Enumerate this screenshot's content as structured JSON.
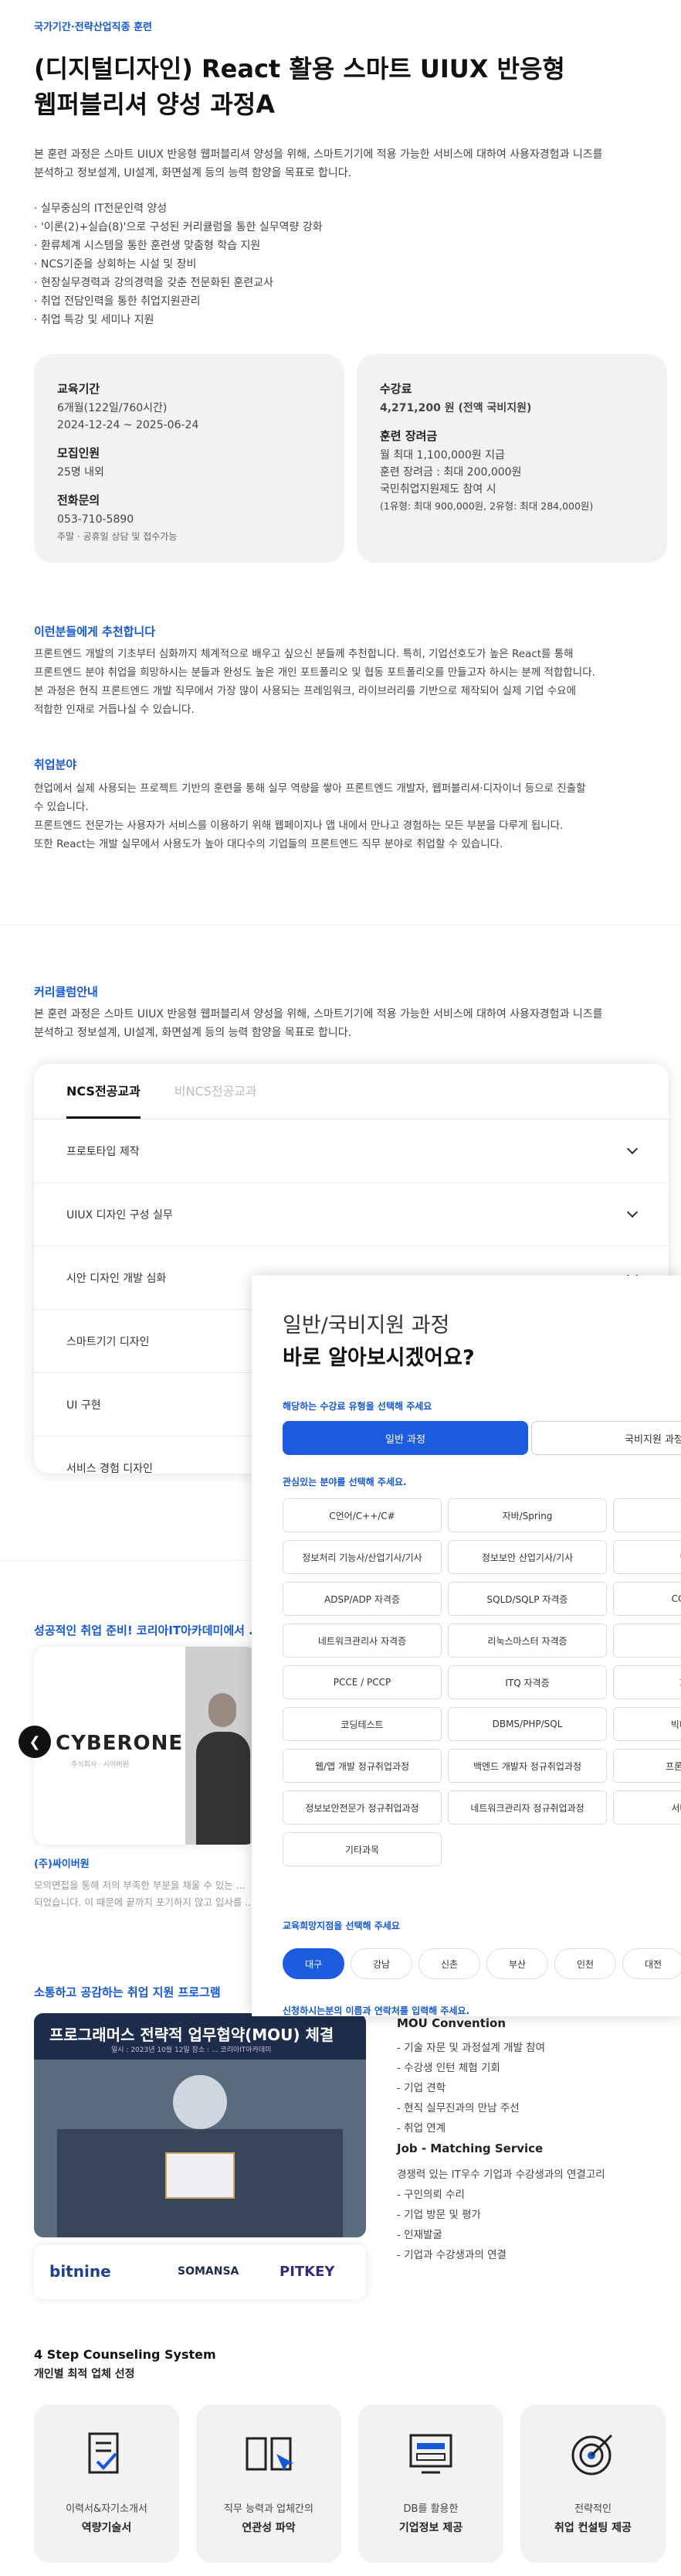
{
  "header": {
    "category": "국가기간·전략산업직종 훈련",
    "title_line1": "(디지털디자인) React 활용 스마트 UIUX 반응형",
    "title_line2": "웹퍼블리셔 양성 과정A"
  },
  "intro": {
    "line1": "본 훈련 과정은 스마트 UIUX 반응형 웹퍼블리셔 양성을 위해, 스마트기기에 적용 가능한 서비스에 대하여 사용자경험과 니즈를",
    "line2": "분석하고 정보설계, UI설계, 화면설계 등의 능력 함양을 목표로 합니다."
  },
  "features": [
    "· 실무중심의 IT전문인력 양성",
    "· '이론(2)+실습(8)'으로 구성된 커리큘럼을 통한 실무역량 강화",
    "· 환류체계 시스템을 통한 훈련생 맞춤형 학습 지원",
    "· NCS기준을 상회하는 시설 및 장비",
    "· 현장실무경력과 강의경력을 갖춘 전문화된 훈련교사",
    "· 취업 전담인력을 통한 취업지원관리",
    "· 취업 특강 및 세미나 지원"
  ],
  "info_left": {
    "period_label": "교육기간",
    "period_v1": "6개월(122일/760시간)",
    "period_v2": "2024-12-24 ~ 2025-06-24",
    "recruit_label": "모집인원",
    "recruit_v": "25명 내외",
    "contact_label": "전화문의",
    "contact_v1": "053-710-5890",
    "contact_v2": "주말 · 공휴일 상담 및 접수가능"
  },
  "info_right": {
    "fee_label": "수강료",
    "fee_v": "4,271,200 원 (전액 국비지원)",
    "incentive_label": "훈련 장려금",
    "incentive_v1": "월 최대 1,100,000원 지급",
    "incentive_v2": "훈련 장려금 : 최대 200,000원",
    "incentive_v3": "국민취업지원제도 참여 시",
    "incentive_v4": "(1유형: 최대 900,000원, 2유형: 최대 284,000원)"
  },
  "recommend": {
    "title": "이런분들에게 추천합니다",
    "l1": "프론트엔드 개발의 기초부터 심화까지 체계적으로 배우고 싶으신 분들께 추천합니다. 특히, 기업선호도가 높은 React를 통해",
    "l2": "프론트엔드 분야 취업을 희망하시는 분들과 완성도 높은 개인 포트폴리오 및 협동 포트폴리오를 만들고자 하시는 분께 적합합니다.",
    "l3": "본 과정은 현직 프론트엔드 개발 직무에서 가장 많이 사용되는 프레임워크, 라이브러리를 기반으로 제작되어 실제 기업 수요에",
    "l4": "적합한 인재로 거듭나실 수 있습니다."
  },
  "jobs": {
    "title": "취업분야",
    "l1": "현업에서 실제 사용되는 프로젝트 기반의 훈련을 통해 실무 역량을 쌓아 프론트엔드 개발자, 웹퍼블리셔·디자이너 등으로 진출할",
    "l2": "수 있습니다.",
    "l3": "프론트엔드 전문가는 사용자가 서비스를 이용하기 위해 웹페이지나 앱 내에서 만나고 경험하는 모든 부분을 다루게 됩니다.",
    "l4": "또한 React는 개발 실무에서 사용도가 높아 대다수의 기업들의 프론트엔드 직무 분야로 취업할 수 있습니다."
  },
  "curriculum": {
    "title": "커리큘럼안내",
    "l1": "본 훈련 과정은 스마트 UIUX 반응형 웹퍼블리셔 양성을 위해, 스마트기기에 적용 가능한 서비스에 대하여 사용자경험과 니즈를",
    "l2": "분석하고 정보설계, UI설계, 화면설계 등의 능력 함양을 목표로 합니다.",
    "tab1": "NCS전공교과",
    "tab2": "비NCS전공교과",
    "items": [
      "프로토타입 제작",
      "UIUX 디자인 구성 실무",
      "시안 디자인 개발 심화",
      "스마트기기 디자인",
      "UI 구현",
      "서비스 경험 디자인"
    ]
  },
  "success": {
    "title": "성공적인 취업 준비! 코리아IT아카데미에서 ...",
    "logo": "CYBERONE",
    "logo_sub": "주식회사 · 사이버원",
    "company": "(주)싸이버원",
    "d1": "모의면접을 통해 저의 부족한 부분을 채울 수 있는 ...",
    "d2": "되었습니다. 이 때문에 끝까지 포기하지 않고 입사를 ..."
  },
  "panel": {
    "title1": "일반/국비지원 과정",
    "title2": "바로 알아보시겠어요?",
    "q1": "해당하는 수강료 유형을 선택해 주세요",
    "type_on": "일반 과정",
    "type_off": "국비지원 과정",
    "q2": "관심있는 분야를 선택해 주세요.",
    "fields": [
      [
        "C언어/C++/C#",
        "자바/Spring",
        "파"
      ],
      [
        "정보처리 기능사/산업기사/기사",
        "정보보안 산업기사/기사",
        "빅데이"
      ],
      [
        "ADSP/ADP 자격증",
        "SQLD/SQLP 자격증",
        "CCNA/CC"
      ],
      [
        "네트워크관리사 자격증",
        "리눅스마스터 자격증",
        "MCF"
      ],
      [
        "PCCE / PCCP",
        "ITQ 자격증",
        "자료구"
      ],
      [
        "코딩테스트",
        "DBMS/PHP/SQL",
        "빅데이터/A"
      ],
      [
        "웹/앱 개발 정규취업과정",
        "백엔드 개발자 정규취업과정",
        "프론트엔드 개"
      ],
      [
        "정보보안전문가 정규취업과정",
        "네트워크관리자 정규취업과정",
        "서버관리자"
      ],
      [
        "기타과목",
        "",
        ""
      ]
    ],
    "q3": "교육희망지점을 선택해 주세요",
    "branches": [
      "대구",
      "강남",
      "신촌",
      "부산",
      "인천",
      "대전"
    ],
    "q4": "신청하시는분의 이름과 연락처를 입력해 주세요."
  },
  "program": {
    "title": "소통하고 공감하는 취업 지원 프로그램",
    "banner": "프로그래머스 전략적 업무협약(MOU) 체결",
    "banner_sub": "일시 : 2023년 10월 12일  장소 : ...  코리아IT아카데미",
    "partners": [
      "bitnine",
      "SOMANSA",
      "PITKEY"
    ],
    "mou_title": "MOU Convention",
    "mou_items": [
      "- 기술 자문 및 과정설계 개발 참여",
      "- 수강생 인턴 체험 기회",
      "- 기업 견학",
      "- 현직 실무진과의 만남 주선",
      "- 취업 연계"
    ],
    "job_title": "Job - Matching Service",
    "job_desc": "경쟁력 있는 IT우수 기업과 수강생과의 연결고리",
    "job_items": [
      "- 구인의뢰 수리",
      "- 기업 방문 및 평가",
      "- 인재발굴",
      "- 기업과 수강생과의 연결"
    ]
  },
  "steps": {
    "title": "4 Step Counseling System",
    "sub": "개인별 최적 업체 선정",
    "cards": [
      {
        "a": "이력서&자기소개서",
        "b": "역량기술서"
      },
      {
        "a": "직무 능력과 업체간의",
        "b": "연관성 파악"
      },
      {
        "a": "DB를 활용한",
        "b": "기업정보 제공"
      },
      {
        "a": "전략적인",
        "b": "취업 컨설팅 제공"
      }
    ]
  }
}
